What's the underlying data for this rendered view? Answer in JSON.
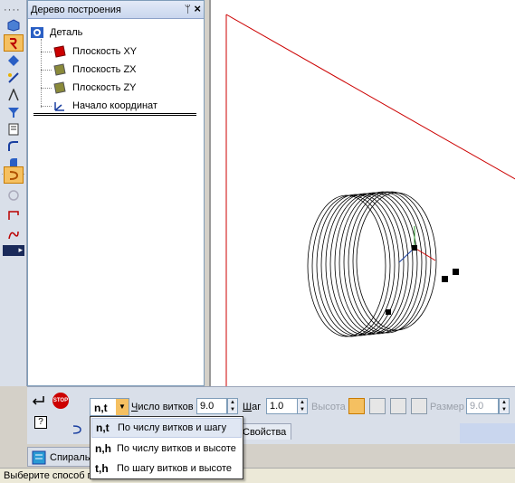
{
  "tree": {
    "title": "Дерево построения",
    "root_label": "Деталь",
    "items": [
      {
        "label": "Плоскость XY",
        "icon": "plane-xy-icon",
        "color": "#cc0000"
      },
      {
        "label": "Плоскость ZX",
        "icon": "plane-zx-icon",
        "color": "#8a8a3a"
      },
      {
        "label": "Плоскость ZY",
        "icon": "plane-zy-icon",
        "color": "#8a8a3a"
      },
      {
        "label": "Начало координат",
        "icon": "origin-icon",
        "color": "#1a3fa0"
      }
    ]
  },
  "properties": {
    "mode_value": "n,t",
    "turns_label_accel": "Ч",
    "turns_label_rest": "исло витков",
    "turns_value": "9.0",
    "step_label_accel": "Ш",
    "step_label_rest": "аг",
    "step_value": "1.0",
    "height_label": "Высота",
    "size_label": "Размер",
    "size_value": "9.0",
    "tab_properties": "Свойства",
    "bottom_tab": "Спираль",
    "help_icon": "?",
    "stop_label": "STOP"
  },
  "dropdown": {
    "items": [
      {
        "code": "n,t",
        "label": "По числу витков и шагу"
      },
      {
        "code": "n,h",
        "label": "По числу витков и высоте"
      },
      {
        "code": "t,h",
        "label": "По шагу витков и высоте"
      }
    ]
  },
  "status": {
    "text": "Выберите способ п"
  },
  "colors": {
    "accent": "#f5c061",
    "selection": "#e0e7f3",
    "plane_line": "#cc0000"
  }
}
